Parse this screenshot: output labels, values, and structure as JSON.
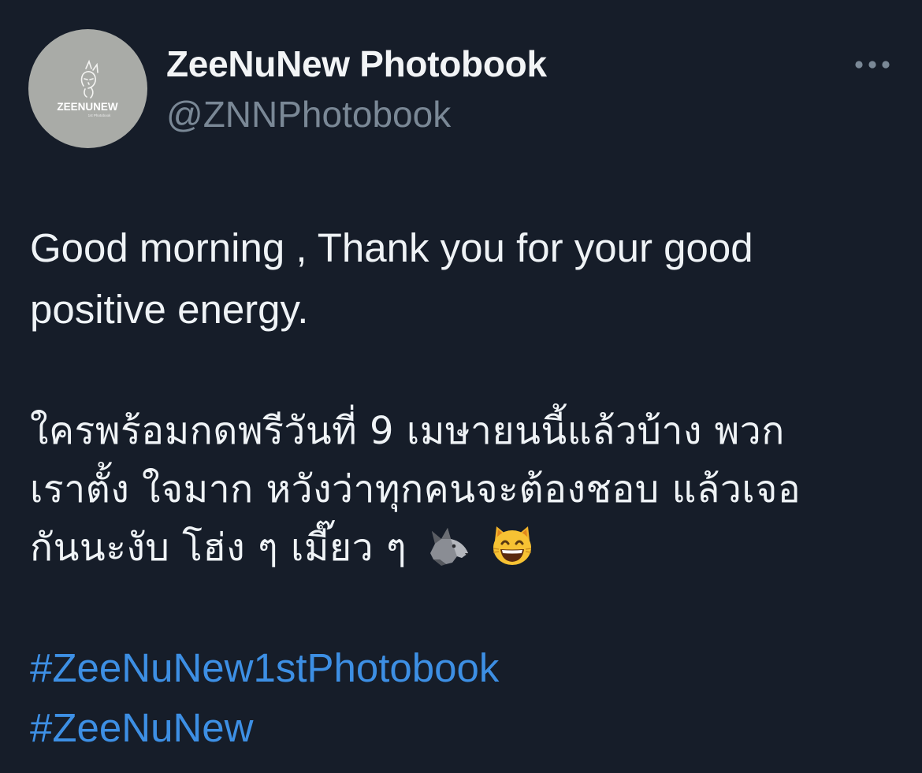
{
  "tweet": {
    "author": {
      "display_name": "ZeeNuNew Photobook",
      "handle": "@ZNNPhotobook",
      "avatar": {
        "logo_text": "ZEENUNEW",
        "logo_subtext": "1st Photobook",
        "background": "#a9aba7"
      }
    },
    "more_icon": "more-horizontal-icon",
    "body": {
      "english_line_1": "Good morning , Thank you for your good",
      "english_line_2": "positive energy.",
      "thai_line_1": "ใครพร้อมกดพรีวันที่ 9 เมษายนนี้แล้วบ้าง พวก",
      "thai_line_2": "เราตั้ง ใจมาก หวังว่าทุกคนจะต้องชอบ แล้วเจอ",
      "thai_line_3": "กันนะงับ โฮ่ง ๆ เมี๊ยว ๆ",
      "emojis": [
        "wolf-emoji",
        "grinning-cat-emoji"
      ]
    },
    "hashtags": [
      "#ZeeNuNew1stPhotobook",
      "#ZeeNuNew"
    ]
  },
  "colors": {
    "background": "#161d29",
    "text": "#eff3f6",
    "secondary_text": "#7a8896",
    "link": "#3d8fe4"
  }
}
